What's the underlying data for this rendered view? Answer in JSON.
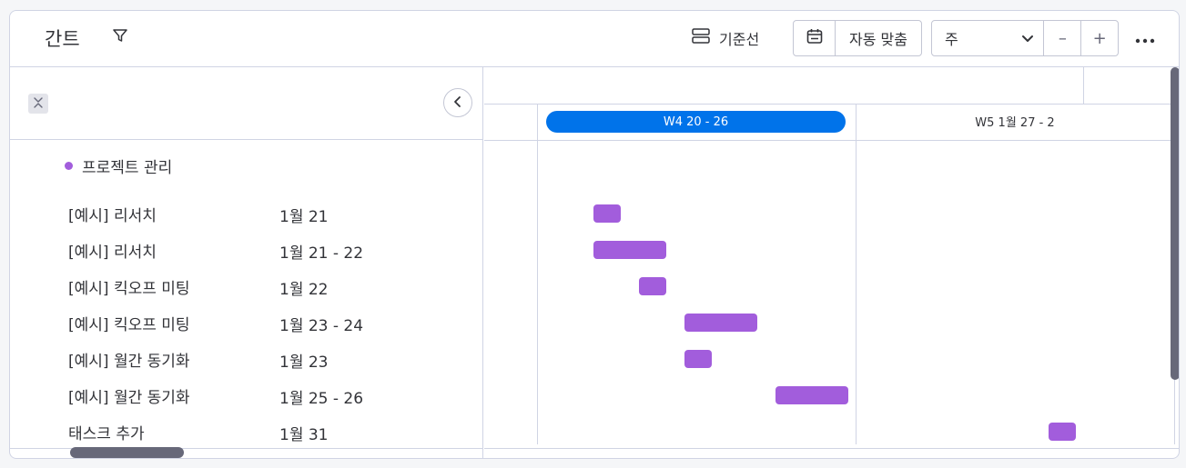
{
  "toolbar": {
    "title": "간트",
    "baseline_label": "기준선",
    "auto_fit_label": "자동 맞춤",
    "zoom_select_value": "주",
    "zoom_out_label": "–",
    "zoom_in_label": "+"
  },
  "colors": {
    "accent": "#0073ea",
    "task_bar": "#a25ddc"
  },
  "group": {
    "label": "프로젝트 관리"
  },
  "tasks": [
    {
      "name": "[예시] 리서치",
      "date": "1월 21",
      "start": "2025-01-21",
      "end": "2025-01-21"
    },
    {
      "name": "[예시] 리서치",
      "date": "1월 21 - 22",
      "start": "2025-01-21",
      "end": "2025-01-22"
    },
    {
      "name": "[예시] 킥오프 미팅",
      "date": "1월 22",
      "start": "2025-01-22",
      "end": "2025-01-22"
    },
    {
      "name": "[예시] 킥오프 미팅",
      "date": "1월 23 - 24",
      "start": "2025-01-23",
      "end": "2025-01-24"
    },
    {
      "name": "[예시] 월간 동기화",
      "date": "1월 23",
      "start": "2025-01-23",
      "end": "2025-01-23"
    },
    {
      "name": "[예시] 월간 동기화",
      "date": "1월 25 - 26",
      "start": "2025-01-25",
      "end": "2025-01-26"
    },
    {
      "name": "태스크 추가",
      "date": "1월 31",
      "start": "2025-01-31",
      "end": "2025-01-31"
    }
  ],
  "timeline": {
    "weeks": [
      {
        "label": "W4 20 - 26",
        "current": true
      },
      {
        "label": "W5 1월 27 - 2",
        "current": false
      }
    ]
  }
}
